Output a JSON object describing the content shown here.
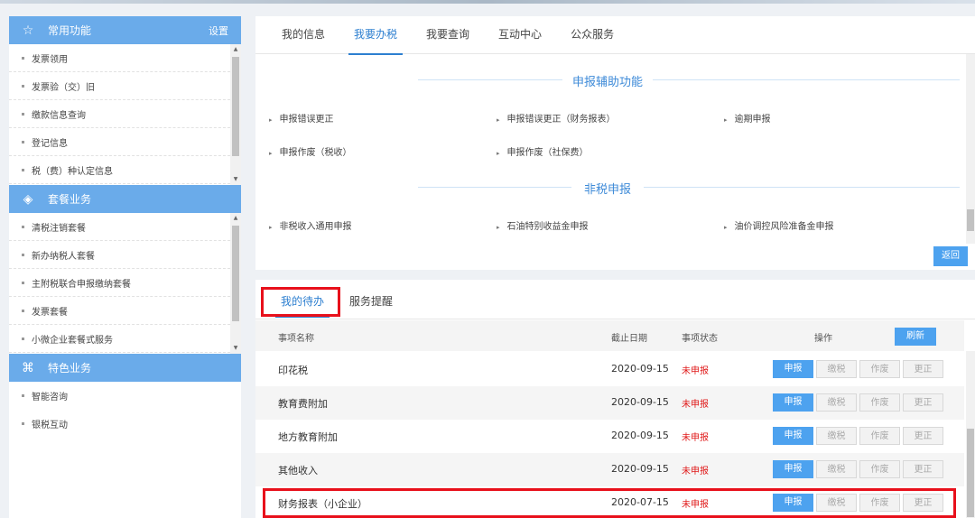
{
  "sidebar": {
    "common": {
      "title": "常用功能",
      "settings_label": "设置",
      "items": [
        "发票领用",
        "发票验（交）旧",
        "缴款信息查询",
        "登记信息",
        "税（费）种认定信息"
      ]
    },
    "package": {
      "title": "套餐业务",
      "items": [
        "清税注销套餐",
        "新办纳税人套餐",
        "主附税联合申报缴纳套餐",
        "发票套餐",
        "小微企业套餐式服务"
      ]
    },
    "special": {
      "title": "特色业务",
      "items": [
        "智能咨询",
        "银税互动"
      ]
    }
  },
  "main_tabs": [
    "我的信息",
    "我要办税",
    "我要查询",
    "互动中心",
    "公众服务"
  ],
  "active_main_tab": "我要办税",
  "aux_section": {
    "title": "申报辅助功能",
    "items": [
      "申报错误更正",
      "申报错误更正（财务报表）",
      "逾期申报",
      "申报作废（税收）",
      "申报作废（社保费）"
    ]
  },
  "nontax_section": {
    "title": "非税申报",
    "items": [
      "非税收入通用申报",
      "石油特别收益金申报",
      "油价调控风险准备金申报"
    ]
  },
  "back_label": "返回",
  "todo_tabs": [
    "我的待办",
    "服务提醒"
  ],
  "table": {
    "headers": {
      "name": "事项名称",
      "deadline": "截止日期",
      "status": "事项状态",
      "ops": "操作"
    },
    "refresh_label": "刷新",
    "op_labels": [
      "申报",
      "缴税",
      "作废",
      "更正"
    ],
    "rows": [
      {
        "name": "印花税",
        "deadline": "2020-09-15",
        "status": "未申报"
      },
      {
        "name": "教育费附加",
        "deadline": "2020-09-15",
        "status": "未申报"
      },
      {
        "name": "地方教育附加",
        "deadline": "2020-09-15",
        "status": "未申报"
      },
      {
        "name": "其他收入",
        "deadline": "2020-09-15",
        "status": "未申报"
      },
      {
        "name": "财务报表（小企业）",
        "deadline": "2020-07-15",
        "status": "未申报"
      }
    ]
  },
  "colors": {
    "accent": "#4da2ef",
    "sidebar_header": "#6aabea",
    "highlight": "#e8101b",
    "status_red": "#e01a1a"
  }
}
